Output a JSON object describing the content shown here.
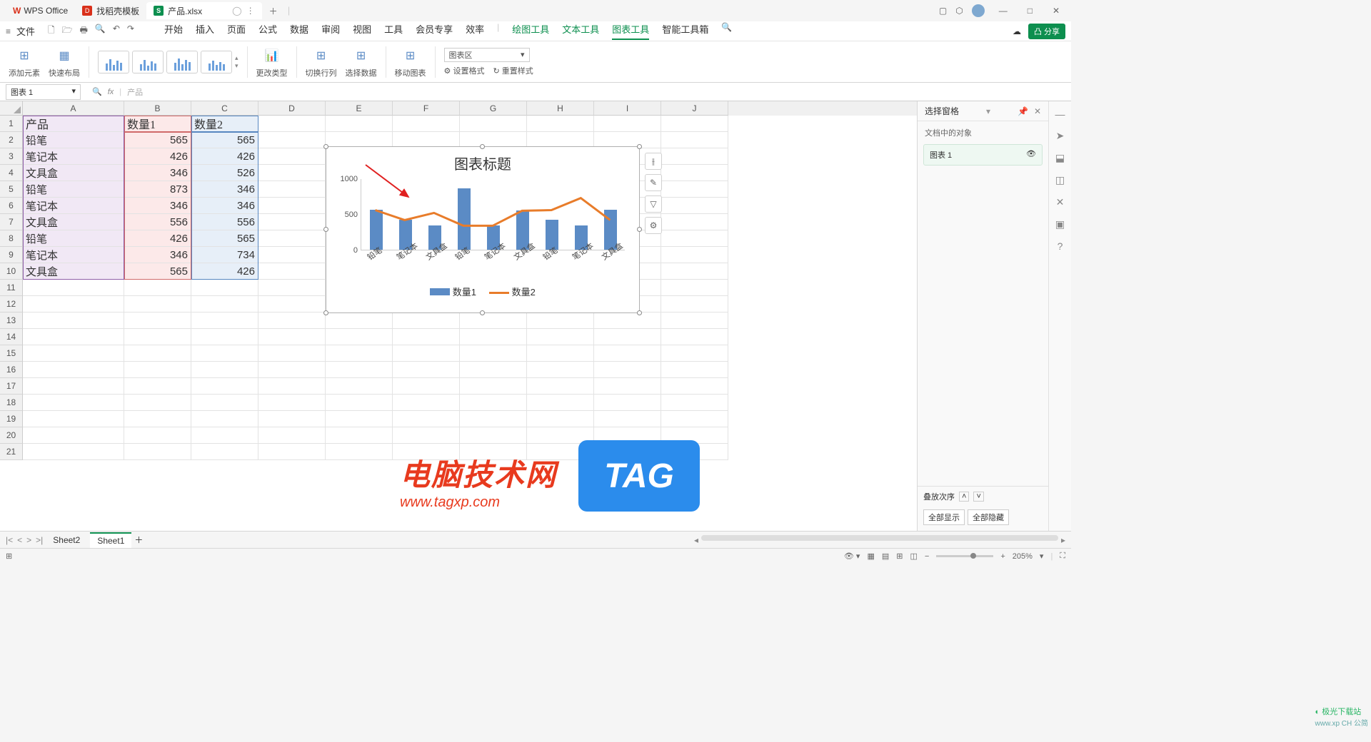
{
  "app_name": "WPS Office",
  "tabs": [
    {
      "label": "找稻壳模板",
      "icon": "D"
    },
    {
      "label": "产品.xlsx",
      "icon": "S",
      "active": true
    }
  ],
  "menu": {
    "file": "文件",
    "items": [
      "开始",
      "插入",
      "页面",
      "公式",
      "数据",
      "审阅",
      "视图",
      "工具",
      "会员专享",
      "效率"
    ],
    "green_items": [
      "绘图工具",
      "文本工具",
      "图表工具",
      "智能工具箱"
    ],
    "active": "图表工具"
  },
  "share_btn": "分享",
  "ribbon": {
    "add_element": "添加元素",
    "quick_layout": "快速布局",
    "change_type": "更改类型",
    "switch_rc": "切换行列",
    "select_data": "选择数据",
    "move_chart": "移动图表",
    "chart_area": "图表区",
    "set_format": "设置格式",
    "reset_style": "重置样式"
  },
  "namebox": "图表 1",
  "formula_text": "产品",
  "columns": [
    "A",
    "B",
    "C",
    "D",
    "E",
    "F",
    "G",
    "H",
    "I",
    "J"
  ],
  "rows": 21,
  "table": {
    "headers": [
      "产品",
      "数量1",
      "数量2"
    ],
    "data": [
      [
        "铅笔",
        565,
        565
      ],
      [
        "笔记本",
        426,
        426
      ],
      [
        "文具盒",
        346,
        526
      ],
      [
        "铅笔",
        873,
        346
      ],
      [
        "笔记本",
        346,
        346
      ],
      [
        "文具盒",
        556,
        556
      ],
      [
        "铅笔",
        426,
        565
      ],
      [
        "笔记本",
        346,
        734
      ],
      [
        "文具盒",
        565,
        426
      ]
    ]
  },
  "chart_data": {
    "type": "bar+line",
    "title": "图表标题",
    "ylim": [
      0,
      1000
    ],
    "yticks": [
      0,
      500,
      1000
    ],
    "categories": [
      "铅笔",
      "笔记本",
      "文具盒",
      "铅笔",
      "笔记本",
      "文具盒",
      "铅笔",
      "笔记本",
      "文具盒"
    ],
    "series": [
      {
        "name": "数量1",
        "type": "bar",
        "color": "#5b8bc5",
        "values": [
          565,
          426,
          346,
          873,
          346,
          556,
          426,
          346,
          565
        ]
      },
      {
        "name": "数量2",
        "type": "line",
        "color": "#e87c2a",
        "values": [
          565,
          426,
          526,
          346,
          346,
          556,
          565,
          734,
          426
        ]
      }
    ]
  },
  "right_panel": {
    "title": "选择窗格",
    "subtitle": "文档中的对象",
    "item": "图表 1",
    "stack_order": "叠放次序",
    "show_all": "全部显示",
    "hide_all": "全部隐藏"
  },
  "sheets": {
    "sheet2": "Sheet2",
    "sheet1": "Sheet1"
  },
  "zoom": "205%",
  "watermark": {
    "title": "电脑技术网",
    "url": "www.tagxp.com",
    "tag": "TAG"
  },
  "corner_brand": "极光下载站",
  "lang_ind": "www.xp CH 公简"
}
